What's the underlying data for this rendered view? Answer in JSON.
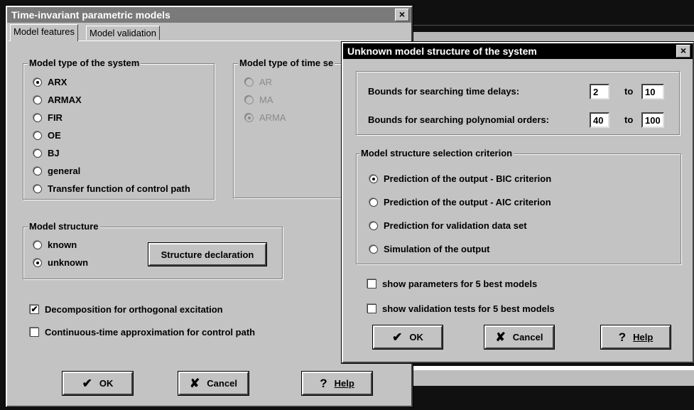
{
  "main_window": {
    "title": "Time-invariant parametric models",
    "close_label": "×",
    "tabs": [
      {
        "label": "Model features",
        "active": true
      },
      {
        "label": "Model validation",
        "active": false
      }
    ],
    "system_group": {
      "label": "Model type of the system",
      "options": [
        {
          "label": "ARX",
          "selected": true
        },
        {
          "label": "ARMAX",
          "selected": false
        },
        {
          "label": "FIR",
          "selected": false
        },
        {
          "label": "OE",
          "selected": false
        },
        {
          "label": "BJ",
          "selected": false
        },
        {
          "label": "general",
          "selected": false
        },
        {
          "label": "Transfer function of control path",
          "selected": false
        }
      ]
    },
    "timeseries_group": {
      "label": "Model type of time se",
      "options": [
        {
          "label": "AR",
          "selected": false
        },
        {
          "label": "MA",
          "selected": false
        },
        {
          "label": "ARMA",
          "selected": true
        }
      ]
    },
    "structure_group": {
      "label": "Model structure",
      "options": [
        {
          "label": "known",
          "selected": false
        },
        {
          "label": "unknown",
          "selected": true
        }
      ],
      "declaration_button": "Structure declaration"
    },
    "checks": [
      {
        "label": "Decomposition for orthogonal excitation",
        "checked": true
      },
      {
        "label": "Continuous-time approximation for control path",
        "checked": false
      }
    ],
    "buttons": {
      "ok": "OK",
      "cancel": "Cancel",
      "help": "Help"
    }
  },
  "dialog": {
    "title": "Unknown model structure of the system",
    "close_label": "×",
    "bounds": {
      "delays_label": "Bounds for searching time delays:",
      "delays_from": "2",
      "delays_to": "10",
      "orders_label": "Bounds for searching polynomial orders:",
      "orders_from": "40",
      "orders_to": "100",
      "to_word": "to"
    },
    "criterion_group": {
      "label": "Model structure selection criterion",
      "options": [
        {
          "label": "Prediction of the output - BIC criterion",
          "selected": true
        },
        {
          "label": "Prediction of the output - AIC criterion",
          "selected": false
        },
        {
          "label": "Prediction for validation data set",
          "selected": false
        },
        {
          "label": "Simulation of the output",
          "selected": false
        }
      ]
    },
    "checks": [
      {
        "label": "show parameters for 5 best models",
        "checked": false
      },
      {
        "label": "show validation tests for 5 best models",
        "checked": false
      }
    ],
    "buttons": {
      "ok": "OK",
      "cancel": "Cancel",
      "help": "Help"
    }
  },
  "icons": {
    "check_mark": "✔",
    "cross_mark": "✘",
    "question_mark": "?"
  }
}
